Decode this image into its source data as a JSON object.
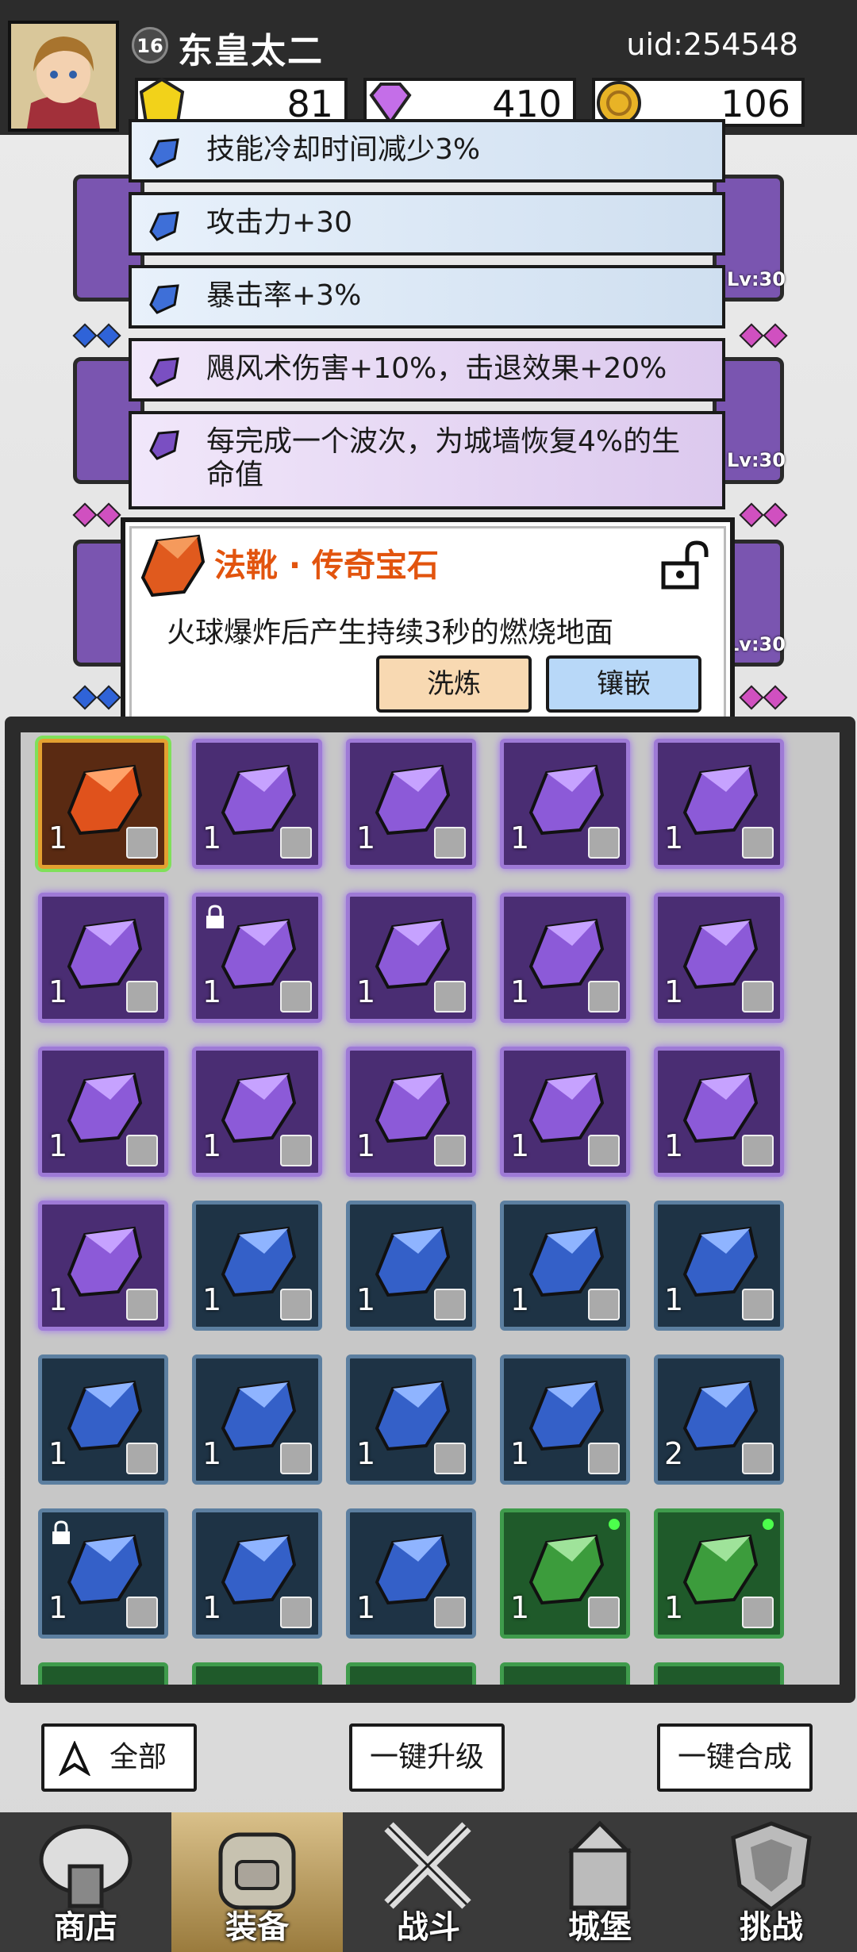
{
  "player": {
    "level": "16",
    "name": "东皇太二",
    "uid": "uid:254548"
  },
  "currencies": [
    {
      "icon": "yellow-gem-icon",
      "value": "81"
    },
    {
      "icon": "purple-diamond-icon",
      "value": "410"
    },
    {
      "icon": "gold-coin-icon",
      "value": "106"
    }
  ],
  "equipment_levels": [
    "Lv:30",
    "Lv:30",
    "Lv:30"
  ],
  "attributes": [
    {
      "color": "blue",
      "text": "技能冷却时间减少3%"
    },
    {
      "color": "blue",
      "text": "攻击力+30"
    },
    {
      "color": "blue",
      "text": "暴击率+3%"
    },
    {
      "color": "purple",
      "text": "飓风术伤害+10%，击退效果+20%"
    },
    {
      "color": "purple",
      "text": "每完成一个波次，为城墙恢复4%的生命值"
    }
  ],
  "gem_detail": {
    "title": "法靴 · 传奇宝石",
    "description": "火球爆炸后产生持续3秒的燃烧地面",
    "reforge_label": "洗炼",
    "inlay_label": "镶嵌"
  },
  "inventory": [
    {
      "rarity": "orange",
      "count": "1",
      "slot": "boots-icon"
    },
    {
      "rarity": "purple",
      "count": "1",
      "slot": "ring-icon"
    },
    {
      "rarity": "purple",
      "count": "1",
      "slot": "ring-icon"
    },
    {
      "rarity": "purple",
      "count": "1",
      "slot": "armor-icon"
    },
    {
      "rarity": "purple",
      "count": "1",
      "slot": "armor-icon"
    },
    {
      "rarity": "purple",
      "count": "1",
      "slot": "armor-icon"
    },
    {
      "rarity": "purple",
      "count": "1",
      "slot": "staff-icon",
      "locked": true
    },
    {
      "rarity": "purple",
      "count": "1",
      "slot": "staff-icon"
    },
    {
      "rarity": "purple",
      "count": "1",
      "slot": "staff-icon"
    },
    {
      "rarity": "purple",
      "count": "1",
      "slot": "staff-icon"
    },
    {
      "rarity": "purple",
      "count": "1",
      "slot": "hat-icon"
    },
    {
      "rarity": "purple",
      "count": "1",
      "slot": "hat-icon"
    },
    {
      "rarity": "purple",
      "count": "1",
      "slot": "necklace-icon"
    },
    {
      "rarity": "purple",
      "count": "1",
      "slot": "necklace-icon"
    },
    {
      "rarity": "purple",
      "count": "1",
      "slot": "necklace-icon"
    },
    {
      "rarity": "purple",
      "count": "1",
      "slot": "necklace-icon"
    },
    {
      "rarity": "blue",
      "count": "1",
      "slot": "ring-icon"
    },
    {
      "rarity": "blue",
      "count": "1",
      "slot": "ring-icon"
    },
    {
      "rarity": "blue",
      "count": "1",
      "slot": "ring-icon"
    },
    {
      "rarity": "blue",
      "count": "1",
      "slot": "ring-icon"
    },
    {
      "rarity": "blue",
      "count": "1",
      "slot": "armor-icon"
    },
    {
      "rarity": "blue",
      "count": "1",
      "slot": "armor-icon"
    },
    {
      "rarity": "blue",
      "count": "1",
      "slot": "hat-icon"
    },
    {
      "rarity": "blue",
      "count": "1",
      "slot": "hat-icon"
    },
    {
      "rarity": "blue",
      "count": "2",
      "slot": "hat-icon"
    },
    {
      "rarity": "blue",
      "count": "1",
      "slot": "necklace-icon",
      "locked": true
    },
    {
      "rarity": "blue",
      "count": "1",
      "slot": "necklace-icon"
    },
    {
      "rarity": "blue",
      "count": "1",
      "slot": "necklace-icon"
    },
    {
      "rarity": "green",
      "count": "1",
      "slot": "armor-icon",
      "new": true
    },
    {
      "rarity": "green",
      "count": "1",
      "slot": "boots-icon",
      "new": true
    }
  ],
  "actions": {
    "filter_label": "全部",
    "upgrade_all_label": "一键升级",
    "merge_all_label": "一键合成"
  },
  "nav": [
    {
      "label": "商店",
      "icon": "shop-icon"
    },
    {
      "label": "装备",
      "icon": "backpack-icon",
      "active": true
    },
    {
      "label": "战斗",
      "icon": "crossed-swords-icon"
    },
    {
      "label": "城堡",
      "icon": "castle-icon"
    },
    {
      "label": "挑战",
      "icon": "shield-icon"
    }
  ],
  "colors": {
    "purple": "#7a4fc2",
    "blue": "#3e6fd8",
    "green": "#3fae4a",
    "orange": "#e2540e"
  }
}
